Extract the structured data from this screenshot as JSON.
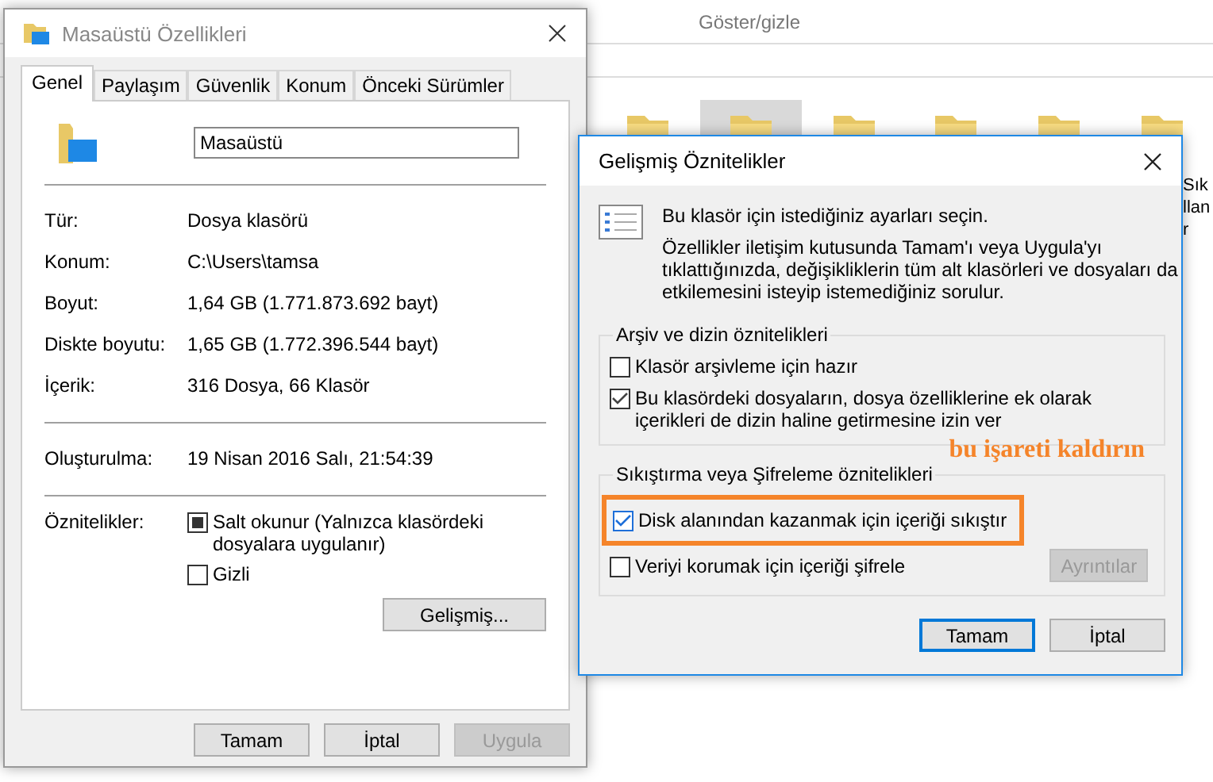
{
  "explorer": {
    "ribbon_group": "Göster/gizle",
    "folders": [
      {
        "selected": false
      },
      {
        "selected": true
      },
      {
        "selected": false
      },
      {
        "selected": false
      },
      {
        "selected": false
      },
      {
        "selected": false
      }
    ],
    "cut_labels": [
      "Sık",
      "llan",
      "r"
    ]
  },
  "properties_dialog": {
    "title": "Masaüstü Özellikleri",
    "tabs": [
      {
        "label": "Genel",
        "selected": true
      },
      {
        "label": "Paylaşım",
        "selected": false
      },
      {
        "label": "Güvenlik",
        "selected": false
      },
      {
        "label": "Konum",
        "selected": false
      },
      {
        "label": "Önceki Sürümler",
        "selected": false
      }
    ],
    "name_value": "Masaüstü",
    "rows": [
      {
        "label": "Tür:",
        "value": "Dosya klasörü"
      },
      {
        "label": "Konum:",
        "value": "C:\\Users\\tamsa"
      },
      {
        "label": "Boyut:",
        "value": "1,64 GB (1.771.873.692 bayt)"
      },
      {
        "label": "Diskte boyutu:",
        "value": "1,65 GB (1.772.396.544 bayt)"
      },
      {
        "label": "İçerik:",
        "value": "316 Dosya, 66 Klasör"
      }
    ],
    "created": {
      "label": "Oluşturulma:",
      "value": "19 Nisan 2016 Salı, 21:54:39"
    },
    "attributes": {
      "label": "Öznitelikler:",
      "options": [
        {
          "label": "Salt okunur (Yalnızca klasördeki dosyalara uygulanır)",
          "checked": false,
          "indeterminate": true
        },
        {
          "label": "Gizli",
          "checked": false,
          "indeterminate": false
        }
      ]
    },
    "advanced_button": "Gelişmiş...",
    "buttons": [
      {
        "label": "Tamam",
        "disabled": false
      },
      {
        "label": "İptal",
        "disabled": false
      },
      {
        "label": "Uygula",
        "disabled": true
      }
    ]
  },
  "advanced_dialog": {
    "title": "Gelişmiş Öznitelikler",
    "intro": "Bu klasör için istediğiniz ayarları seçin.",
    "description": "Özellikler iletişim kutusunda Tamam'ı veya Uygula'yı tıklattığınızda, değişikliklerin tüm alt klasörleri ve dosyaları da etkilemesini isteyip istemediğiniz sorulur.",
    "groups": [
      {
        "title": "Arşiv ve dizin öznitelikleri",
        "options": [
          {
            "label": "Klasör arşivleme için hazır",
            "checked": false,
            "highlighted": false
          },
          {
            "label": "Bu klasördeki dosyaların, dosya özelliklerine ek olarak içerikleri de dizin haline getirmesine izin ver",
            "checked": true,
            "highlighted": false
          }
        ]
      },
      {
        "title": "Sıkıştırma veya Şifreleme öznitelikleri",
        "options": [
          {
            "label": "Disk alanından kazanmak için içeriği sıkıştır",
            "checked": true,
            "highlighted": true
          },
          {
            "label": "Veriyi korumak için içeriği şifrele",
            "checked": false,
            "highlighted": false
          }
        ]
      }
    ],
    "details_button": {
      "label": "Ayrıntılar",
      "disabled": true
    },
    "buttons": [
      {
        "label": "Tamam",
        "default": true
      },
      {
        "label": "İptal",
        "default": false
      }
    ]
  },
  "annotation": {
    "text": "bu işareti kaldırın"
  }
}
